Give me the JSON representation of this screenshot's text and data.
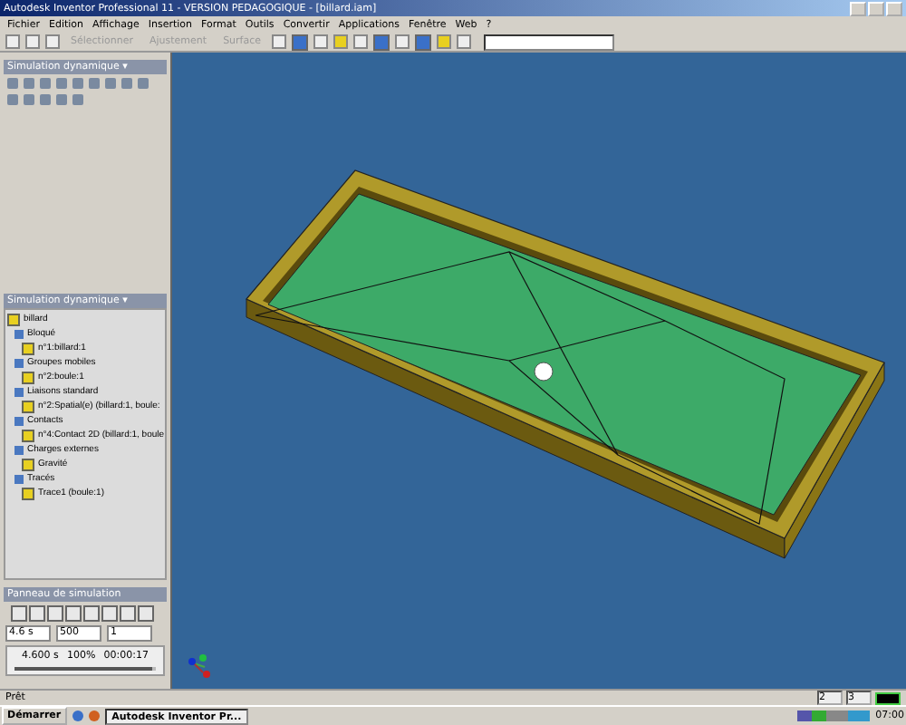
{
  "window": {
    "title": "Autodesk Inventor Professional 11 - VERSION PEDAGOGIQUE - [billard.iam]"
  },
  "menu": [
    "Fichier",
    "Edition",
    "Affichage",
    "Insertion",
    "Format",
    "Outils",
    "Convertir",
    "Applications",
    "Fenêtre",
    "Web",
    "?"
  ],
  "toolbar": {
    "items": [
      "Sélectionner",
      "Ajustement",
      "Surface"
    ]
  },
  "top_panel": {
    "title": "Simulation dynamique ▾"
  },
  "browser": {
    "title": "Simulation dynamique ▾",
    "tree": [
      {
        "label": "billard",
        "children": [
          {
            "label": "Bloqué",
            "children": [
              {
                "label": "n°1:billard:1"
              }
            ]
          },
          {
            "label": "Groupes mobiles",
            "children": [
              {
                "label": "n°2:boule:1"
              }
            ]
          },
          {
            "label": "Liaisons standard",
            "children": [
              {
                "label": "n°2:Spatial(e) (billard:1, boule:"
              }
            ]
          },
          {
            "label": "Contacts",
            "children": [
              {
                "label": "n°4:Contact 2D (billard:1, boule"
              }
            ]
          },
          {
            "label": "Charges externes",
            "children": [
              {
                "label": "Gravité"
              }
            ]
          },
          {
            "label": "Tracés",
            "children": [
              {
                "label": "Trace1 (boule:1)"
              }
            ]
          }
        ]
      }
    ]
  },
  "sim_panel": {
    "title": "Panneau de simulation",
    "fields": [
      "4.6 s",
      "500",
      "1"
    ],
    "readings": [
      "4.600 s",
      "100%",
      "00:00:17"
    ],
    "progress": {
      "level": 0.97
    }
  },
  "status_bar": {
    "text": "Prêt",
    "cells": [
      "2",
      "3"
    ]
  },
  "taskbar": {
    "start": "Démarrer",
    "tasks": [
      "Autodesk Inventor Pr..."
    ],
    "clock": "07:00"
  }
}
